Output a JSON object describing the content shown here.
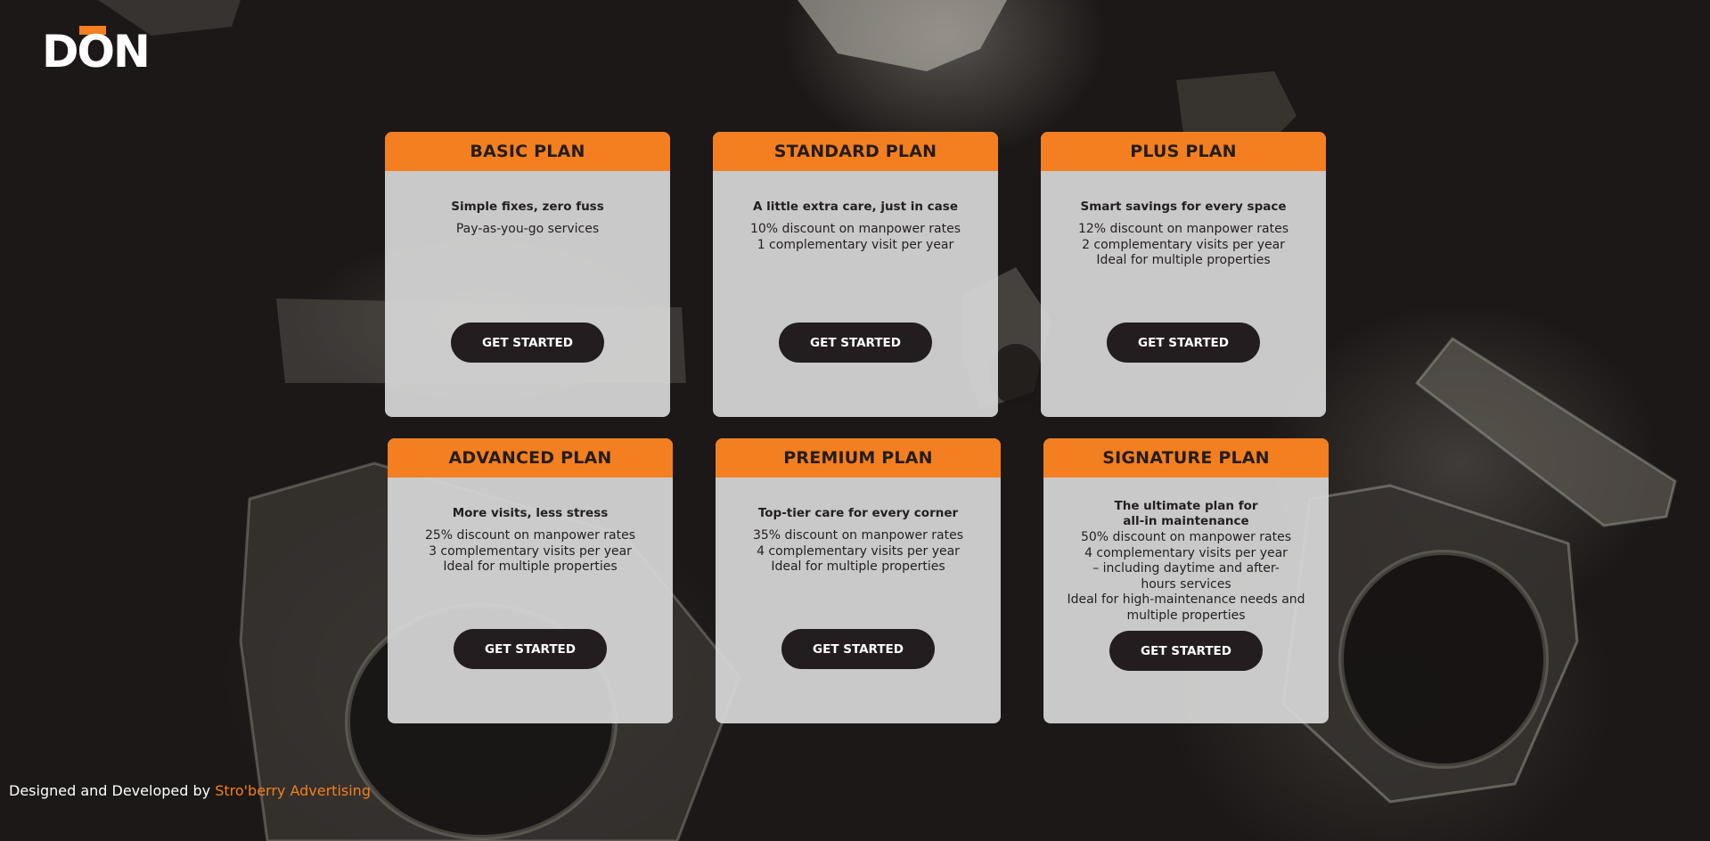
{
  "brand": {
    "logo_text": "DON",
    "accent_color": "#f47f20",
    "dark_color": "#231d1f"
  },
  "plans": [
    {
      "title": "BASIC PLAN",
      "tagline": "Simple fixes, zero fuss",
      "features": [
        "Pay-as-you-go services"
      ],
      "cta": "GET STARTED"
    },
    {
      "title": "STANDARD PLAN",
      "tagline": "A little extra care, just in case",
      "features": [
        "10% discount on manpower rates",
        "1 complementary visit per year"
      ],
      "cta": "GET STARTED"
    },
    {
      "title": "PLUS PLAN",
      "tagline": "Smart savings for every space",
      "features": [
        "12% discount on manpower rates",
        "2 complementary visits per year",
        "Ideal for multiple properties"
      ],
      "cta": "GET STARTED"
    },
    {
      "title": "ADVANCED PLAN",
      "tagline": "More visits, less stress",
      "features": [
        "25% discount on manpower rates",
        "3 complementary visits per year",
        "Ideal for multiple properties"
      ],
      "cta": "GET STARTED"
    },
    {
      "title": "PREMIUM PLAN",
      "tagline": "Top-tier care for every corner",
      "features": [
        "35% discount on manpower rates",
        "4 complementary visits per year",
        "Ideal for multiple properties"
      ],
      "cta": "GET STARTED"
    },
    {
      "title": "SIGNATURE PLAN",
      "tagline_line1": "The ultimate plan for",
      "tagline_line2": "all-in maintenance",
      "features": [
        "50% discount on manpower rates",
        "4 complementary visits per year",
        "– including daytime and after-hours services",
        "Ideal for high-maintenance needs and multiple properties"
      ],
      "cta": "GET STARTED"
    }
  ],
  "footer": {
    "prefix": "Designed and Developed by",
    "link": "Stro'berry Advertising"
  }
}
